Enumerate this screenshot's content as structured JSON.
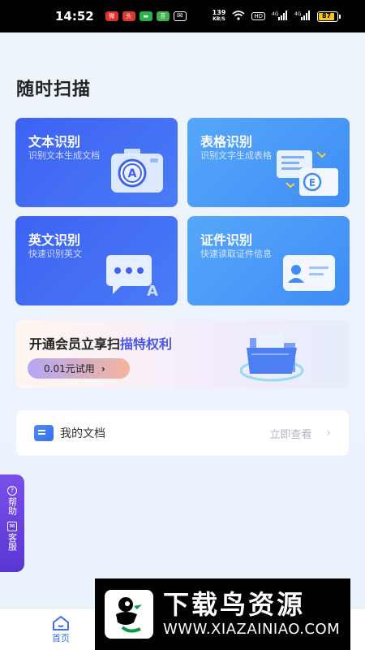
{
  "status_bar": {
    "time": "14:52",
    "app_icons": [
      {
        "name": "weibo-app",
        "color": "#e0312a",
        "text": "微"
      },
      {
        "name": "news-app",
        "color": "#d93a2f",
        "text": "头条"
      },
      {
        "name": "wechat-app",
        "color": "#27b34a",
        "text": "微"
      },
      {
        "name": "green-app",
        "color": "#3bb24a",
        "text": "苔"
      },
      {
        "name": "mail-icon",
        "color": "#000000",
        "text": "✉"
      }
    ],
    "net_speed_value": "139",
    "net_speed_unit": "KB/S",
    "hd_label": "HD",
    "signal_1": "4G",
    "signal_2": "4G",
    "battery": "87"
  },
  "page": {
    "title": "随时扫描"
  },
  "cards": [
    {
      "title": "文本识别",
      "subtitle": "识别文本生成文档"
    },
    {
      "title": "表格识别",
      "subtitle": "识别文字生成表格"
    },
    {
      "title": "英文识别",
      "subtitle": "快速识别英文"
    },
    {
      "title": "证件识别",
      "subtitle": "快速读取证件信息"
    }
  ],
  "vip": {
    "title_prefix": "开通会员立享扫",
    "title_highlight": "描特权利",
    "button_label": "0.01元试用",
    "button_chevron": "›"
  },
  "docs": {
    "label": "我的文档",
    "action": "立即查看",
    "chevron": "›"
  },
  "help_tab": {
    "help_label": "帮助",
    "service_label": "客服"
  },
  "tabbar": {
    "home_label": "首页"
  },
  "watermark": {
    "title": "下载鸟资源",
    "url": "WWW.XIAZAINIAO.COM"
  },
  "colors": {
    "primary": "#3e6ef2",
    "card_blue": "#3d62f3",
    "card_sky": "#56a7fb",
    "help_purple": "#6a42dd"
  }
}
